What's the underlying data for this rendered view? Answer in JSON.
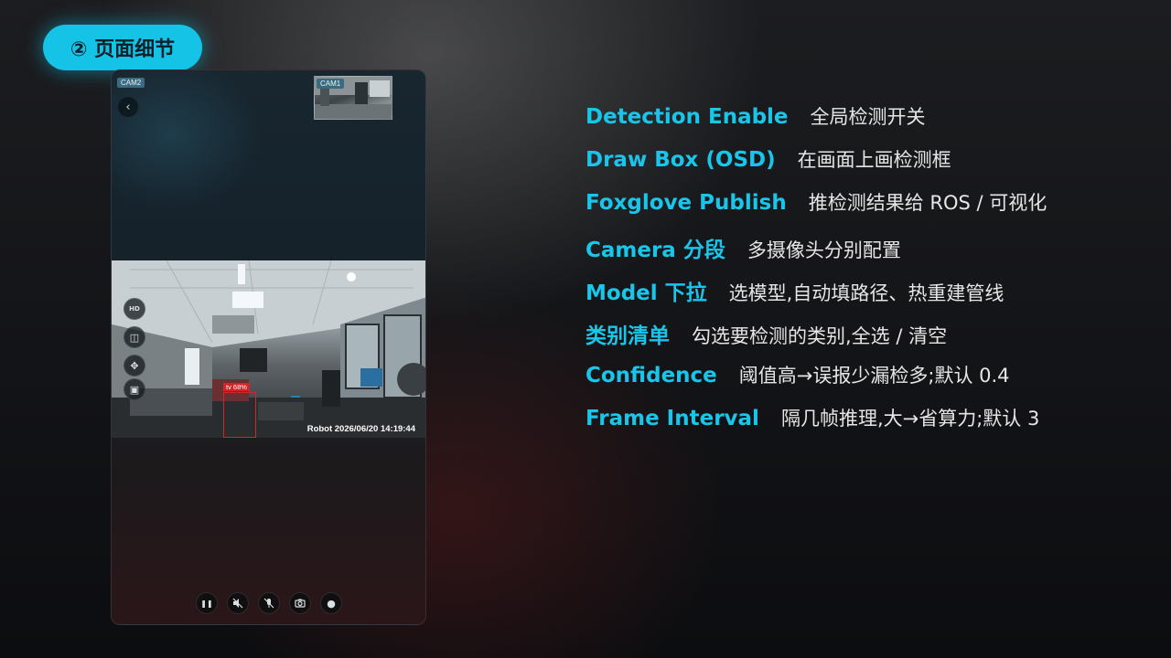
{
  "section_title": "② 页面细节",
  "phone": {
    "main_cam_label": "CAM2",
    "pip_cam_label": "CAM1",
    "back_icon": "chevron-left-icon",
    "detection_label": "tv 68%",
    "timestamp": "Robot  2026/06/20 14:19:44",
    "side_tools": [
      {
        "name": "hd-icon",
        "glyph": "HD"
      },
      {
        "name": "split-screen-icon",
        "glyph": "◫"
      },
      {
        "name": "move-icon",
        "glyph": "✥"
      },
      {
        "name": "picture-in-picture-icon",
        "glyph": "▣"
      }
    ],
    "controls": [
      {
        "name": "pause-button",
        "glyph": "❚❚"
      },
      {
        "name": "mute-speaker-button",
        "glyph": "🔇"
      },
      {
        "name": "mute-mic-button",
        "glyph": "🎙"
      },
      {
        "name": "snapshot-button",
        "glyph": "📷"
      },
      {
        "name": "record-button",
        "glyph": "●"
      }
    ]
  },
  "features": [
    {
      "key": "Detection Enable",
      "desc": "全局检测开关"
    },
    {
      "key": "Draw Box (OSD)",
      "desc": "在画面上画检测框"
    },
    {
      "key": "Foxglove Publish",
      "desc": "推检测结果给 ROS / 可视化"
    },
    {
      "key": "Camera 分段",
      "desc": "多摄像头分别配置"
    },
    {
      "key": "Model 下拉",
      "desc": "选模型,自动填路径、热重建管线"
    },
    {
      "key": "类别清单",
      "desc": "勾选要检测的类别,全选 / 清空"
    },
    {
      "key": "Confidence",
      "desc": "阈值高→误报少漏检多;默认 0.4"
    },
    {
      "key": "Frame Interval",
      "desc": "隔几帧推理,大→省算力;默认 3"
    }
  ],
  "colors": {
    "accent": "#19c6ea",
    "pill": "#14c3e6",
    "detection": "#d0262b"
  }
}
